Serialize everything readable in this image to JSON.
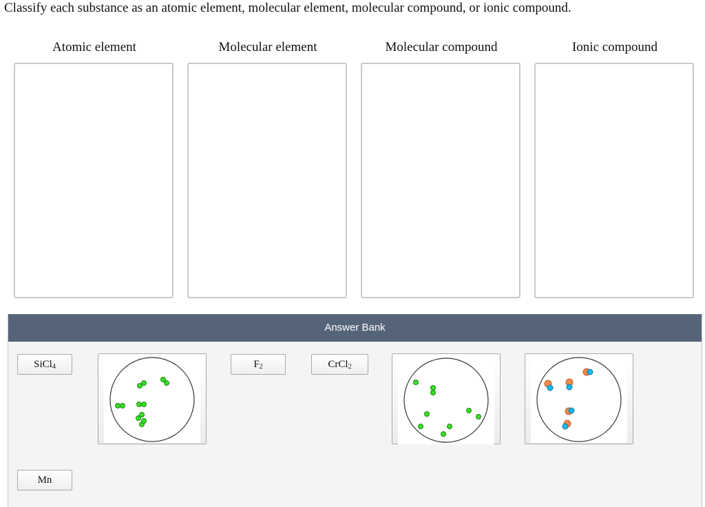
{
  "instructions": "Classify each substance as an atomic element, molecular element, molecular compound, or ionic compound.",
  "categories": [
    "Atomic element",
    "Molecular element",
    "Molecular compound",
    "Ionic compound"
  ],
  "answer_bank": {
    "title": "Answer Bank",
    "chips": [
      {
        "base": "SiCl",
        "sub": "4",
        "suffix": ""
      },
      {
        "base": "F",
        "sub": "2",
        "suffix": ""
      },
      {
        "base": "CrCl",
        "sub": "2",
        "suffix": ""
      },
      {
        "base": "Mn",
        "sub": "",
        "suffix": ""
      }
    ],
    "images": [
      "diatomic-green-molecules",
      "single-green-atoms",
      "orange-blue-ion-pairs"
    ]
  },
  "colors": {
    "header": "#556479",
    "green_atom": "#3ddc2a",
    "orange_ion": "#f08a4b",
    "blue_ion": "#1fb6e8"
  }
}
